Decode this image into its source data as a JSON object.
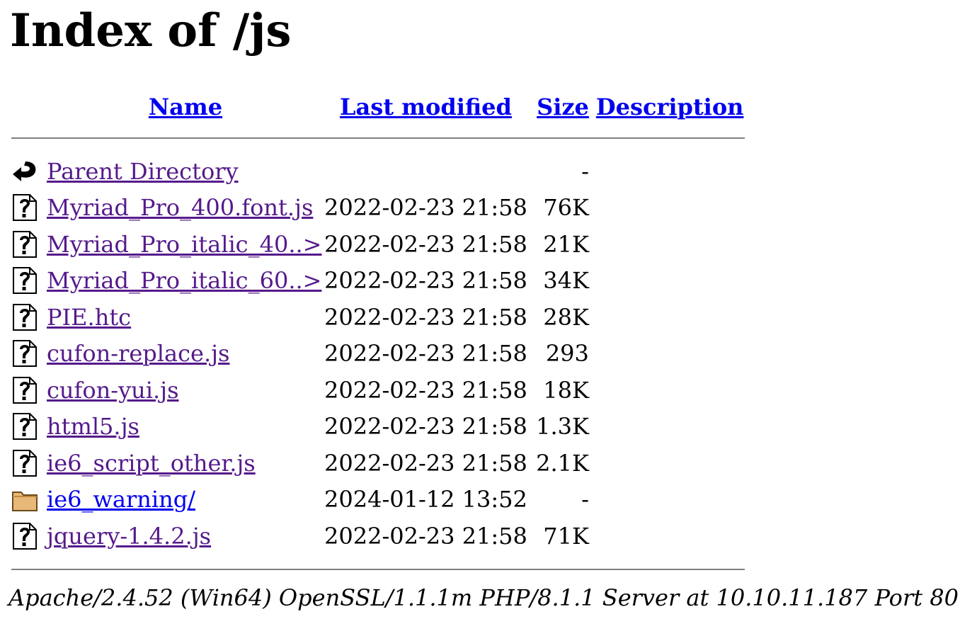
{
  "title": "Index of /js",
  "columns": {
    "name": "Name",
    "last_modified": "Last modified",
    "size": "Size",
    "description": "Description"
  },
  "rows": [
    {
      "icon": "back-icon",
      "name": "Parent Directory",
      "modified": "",
      "size": "-",
      "visited": true
    },
    {
      "icon": "unknown-file-icon",
      "name": "Myriad_Pro_400.font.js",
      "modified": "2022-02-23 21:58",
      "size": "76K",
      "visited": true
    },
    {
      "icon": "unknown-file-icon",
      "name": "Myriad_Pro_italic_40..>",
      "modified": "2022-02-23 21:58",
      "size": "21K",
      "visited": true
    },
    {
      "icon": "unknown-file-icon",
      "name": "Myriad_Pro_italic_60..>",
      "modified": "2022-02-23 21:58",
      "size": "34K",
      "visited": true
    },
    {
      "icon": "unknown-file-icon",
      "name": "PIE.htc",
      "modified": "2022-02-23 21:58",
      "size": "28K",
      "visited": true
    },
    {
      "icon": "unknown-file-icon",
      "name": "cufon-replace.js",
      "modified": "2022-02-23 21:58",
      "size": "293",
      "visited": true
    },
    {
      "icon": "unknown-file-icon",
      "name": "cufon-yui.js",
      "modified": "2022-02-23 21:58",
      "size": "18K",
      "visited": true
    },
    {
      "icon": "unknown-file-icon",
      "name": "html5.js",
      "modified": "2022-02-23 21:58",
      "size": "1.3K",
      "visited": true
    },
    {
      "icon": "unknown-file-icon",
      "name": "ie6_script_other.js",
      "modified": "2022-02-23 21:58",
      "size": "2.1K",
      "visited": true
    },
    {
      "icon": "folder-icon",
      "name": "ie6_warning/",
      "modified": "2024-01-12 13:52",
      "size": "-",
      "visited": false
    },
    {
      "icon": "unknown-file-icon",
      "name": "jquery-1.4.2.js",
      "modified": "2022-02-23 21:58",
      "size": "71K",
      "visited": true
    }
  ],
  "footer": "Apache/2.4.52 (Win64) OpenSSL/1.1.1m PHP/8.1.1 Server at 10.10.11.187 Port 80",
  "colors": {
    "link": "#0000ee",
    "visited_link": "#551a8b",
    "rule": "#808080"
  }
}
